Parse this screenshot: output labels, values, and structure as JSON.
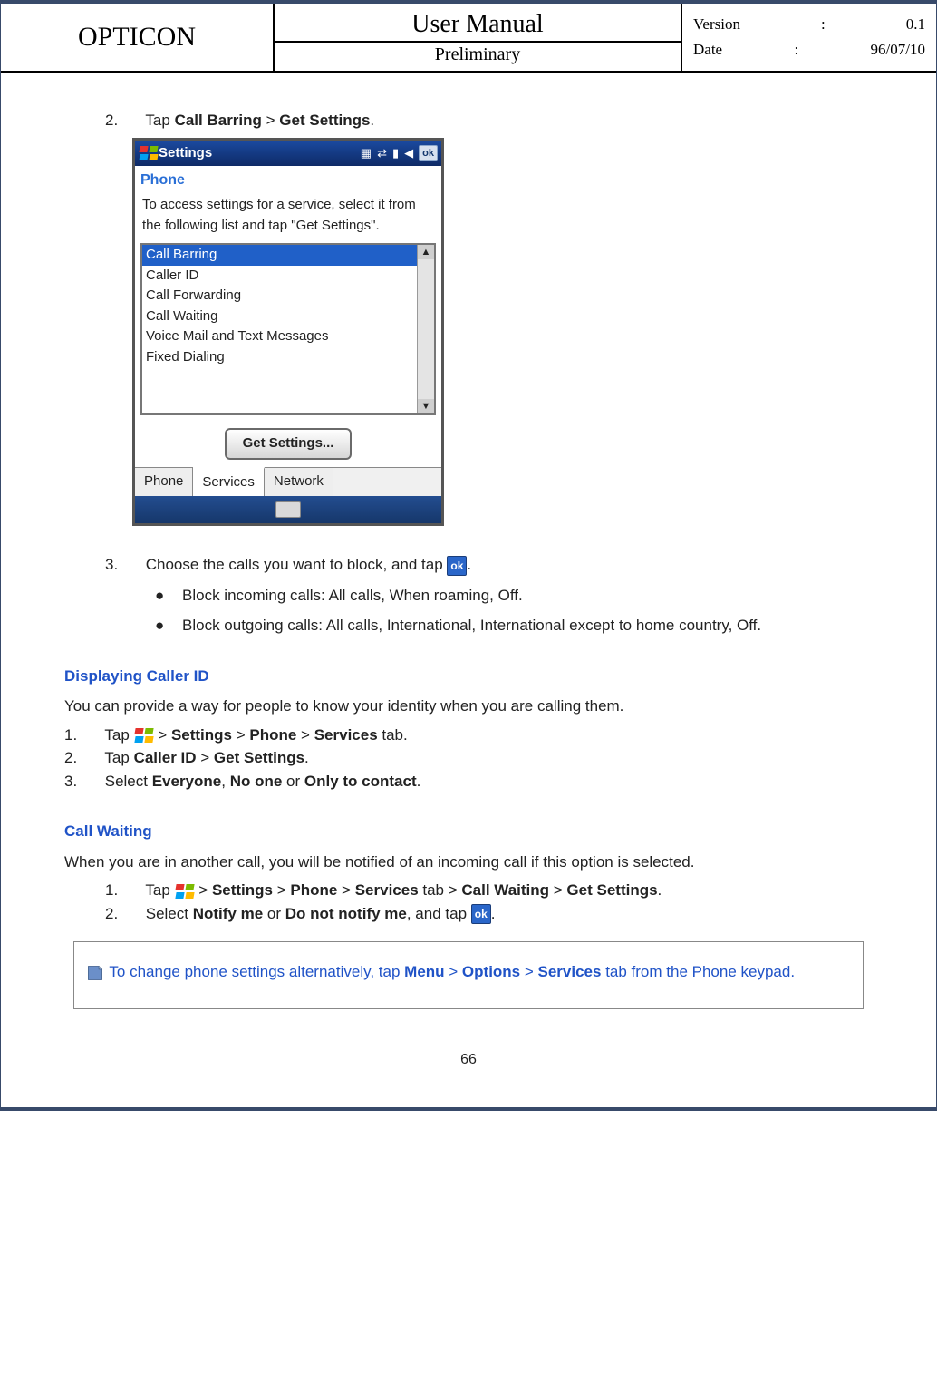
{
  "header": {
    "brand": "OPTICON",
    "title": "User Manual",
    "subtitle": "Preliminary",
    "version_label": "Version",
    "version_value": "0.1",
    "date_label": "Date",
    "date_value": "96/07/10"
  },
  "step2": {
    "num": "2.",
    "pre": "Tap ",
    "b1": "Call Barring",
    "mid": " > ",
    "b2": "Get Settings",
    "post": "."
  },
  "device": {
    "title": "Settings",
    "ok": "ok",
    "sub": "Phone",
    "instr": "To access settings for a service, select it from the following list and tap \"Get Settings\".",
    "items": [
      "Call Barring",
      "Caller ID",
      "Call Forwarding",
      "Call Waiting",
      "Voice Mail and Text Messages",
      "Fixed Dialing"
    ],
    "get_btn": "Get Settings...",
    "tabs": [
      "Phone",
      "Services",
      "Network"
    ]
  },
  "step3": {
    "num": "3.",
    "text": "Choose the calls you want to block, and tap ",
    "ok": "ok",
    "post": ".",
    "b1": "Block incoming calls: All calls, When roaming, Off.",
    "b2": "Block outgoing calls: All calls, International, International except to home country, Off."
  },
  "caller_id": {
    "title": "Displaying Caller ID",
    "intro": "You can provide a way for people to know your identity when you are calling them.",
    "s1_num": "1.",
    "s1_pre": "Tap ",
    "s1_mid": "  > ",
    "s1_b1": "Settings",
    "s1_b2": "Phone",
    "s1_b3": "Services",
    "s1_post": " tab.",
    "s2_num": "2.",
    "s2_pre": "Tap ",
    "s2_b1": "Caller ID",
    "s2_mid": " > ",
    "s2_b2": "Get Settings",
    "s2_post": ".",
    "s3_num": "3.",
    "s3_pre": "Select ",
    "s3_b1": "Everyone",
    "s3_mid1": ", ",
    "s3_b2": "No one",
    "s3_mid2": " or ",
    "s3_b3": "Only to contact",
    "s3_post": "."
  },
  "call_waiting": {
    "title": "Call Waiting",
    "intro": "When you are in another call, you will be notified of an incoming call if this option is selected.",
    "s1_num": "1.",
    "s1_pre": "Tap ",
    "s1_mid": "  > ",
    "s1_b1": "Settings",
    "s1_b2": "Phone",
    "s1_b3": "Services",
    "s1_mid2": " tab > ",
    "s1_b4": "Call Waiting",
    "s1_mid3": " > ",
    "s1_b5": "Get Settings",
    "s1_post": ".",
    "s2_num": "2.",
    "s2_pre": "Select ",
    "s2_b1": "Notify me",
    "s2_mid": " or ",
    "s2_b2": "Do not notify me",
    "s2_mid2": ", and tap ",
    "s2_ok": "ok",
    "s2_post": "."
  },
  "tip": {
    "pre": " To change phone settings alternatively, tap ",
    "b1": "Menu",
    "mid1": " > ",
    "b2": "Options",
    "mid2": " > ",
    "b3": "Services",
    "post": " tab from the Phone keypad."
  },
  "page_number": "66"
}
